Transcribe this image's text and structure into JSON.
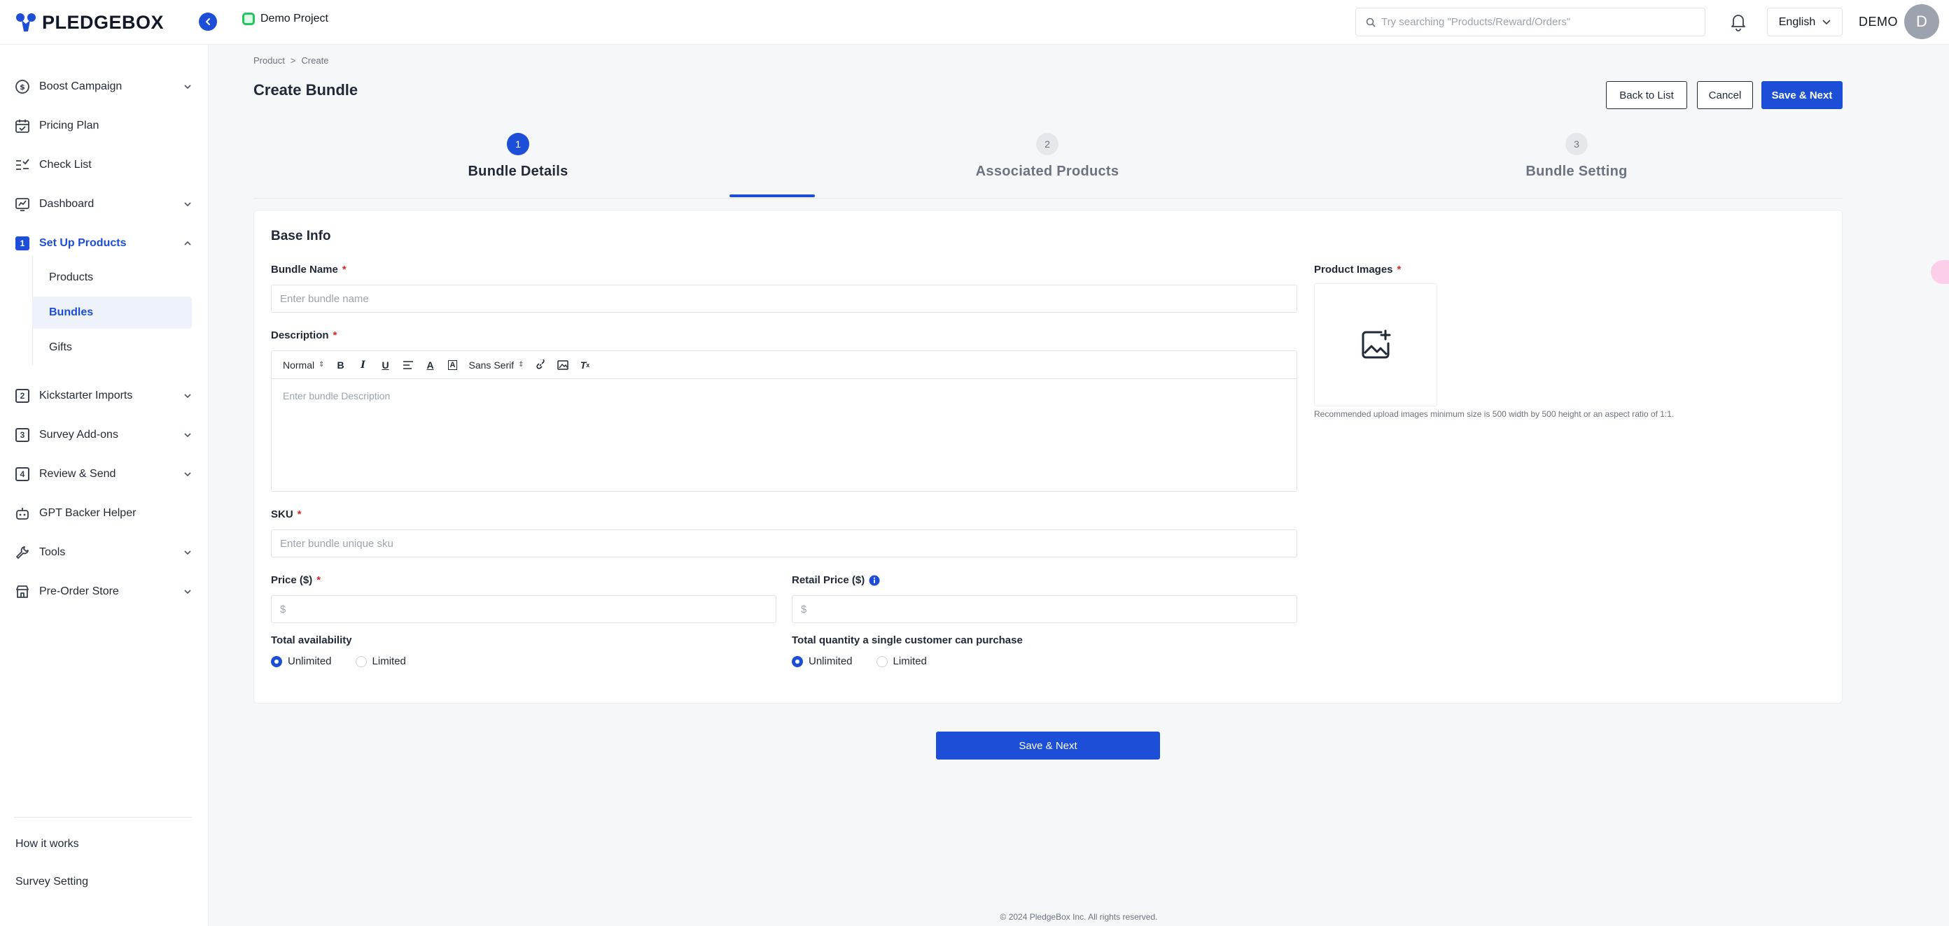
{
  "brand": {
    "name": "PLEDGEBOX",
    "color": "#1d4ed8"
  },
  "header": {
    "project": "Demo Project",
    "search_placeholder": "Try searching \"Products/Reward/Orders\"",
    "language": "English",
    "user": "DEMO",
    "avatar_initial": "D"
  },
  "sidebar": {
    "items": [
      {
        "label": "Boost Campaign"
      },
      {
        "label": "Pricing Plan"
      },
      {
        "label": "Check List"
      },
      {
        "label": "Dashboard"
      },
      {
        "label": "Set Up Products",
        "num": "1"
      },
      {
        "label": "Kickstarter Imports",
        "num": "2"
      },
      {
        "label": "Survey Add-ons",
        "num": "3"
      },
      {
        "label": "Review & Send",
        "num": "4"
      },
      {
        "label": "GPT Backer Helper"
      },
      {
        "label": "Tools"
      },
      {
        "label": "Pre-Order Store"
      }
    ],
    "sub_items": [
      "Products",
      "Bundles",
      "Gifts"
    ],
    "bottom_links": [
      "How it works",
      "Survey Setting"
    ]
  },
  "breadcrumb": {
    "parent": "Product",
    "sep": ">",
    "current": "Create"
  },
  "page": {
    "title": "Create Bundle"
  },
  "actions": {
    "back": "Back to List",
    "cancel": "Cancel",
    "save_next": "Save & Next"
  },
  "steps": [
    {
      "num": "1",
      "label": "Bundle Details"
    },
    {
      "num": "2",
      "label": "Associated Products"
    },
    {
      "num": "3",
      "label": "Bundle Setting"
    }
  ],
  "form": {
    "section_title": "Base Info",
    "required_mark": "*",
    "bundle_name": {
      "label": "Bundle Name",
      "placeholder": "Enter bundle name"
    },
    "description": {
      "label": "Description",
      "placeholder": "Enter bundle Description",
      "toolbar": {
        "format": "Normal",
        "font": "Sans Serif"
      }
    },
    "sku": {
      "label": "SKU",
      "placeholder": "Enter bundle unique sku"
    },
    "price": {
      "label": "Price ($)",
      "placeholder": "$"
    },
    "retail_price": {
      "label": "Retail Price ($)",
      "placeholder": "$"
    },
    "availability": {
      "label": "Total availability",
      "options": [
        "Unlimited",
        "Limited"
      ],
      "selected": "Unlimited"
    },
    "per_customer": {
      "label": "Total quantity a single customer can purchase",
      "options": [
        "Unlimited",
        "Limited"
      ],
      "selected": "Unlimited"
    },
    "images": {
      "label": "Product Images",
      "hint": "Recommended upload images minimum size is 500 width by 500 height or an aspect ratio of 1:1."
    }
  },
  "footer": {
    "copyright": "© 2024 PledgeBox Inc. All rights reserved."
  }
}
